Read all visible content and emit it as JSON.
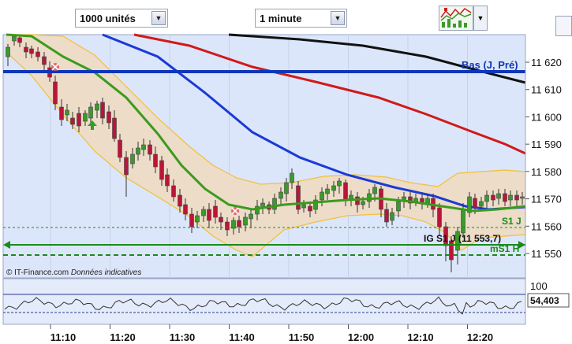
{
  "toolbar": {
    "units_select": "1000 unités",
    "period_select": "1 minute",
    "indicator_tool": "indicator-chart-icon",
    "dropdown_icon": "chevron-down-icon"
  },
  "chart": {
    "price_ticks": [
      "11 620",
      "11 610",
      "11 600",
      "11 590",
      "11 580",
      "11 570",
      "11 560",
      "11 550"
    ],
    "time_ticks": [
      "11:10",
      "11:20",
      "11:30",
      "11:40",
      "11:50",
      "12:00",
      "12:10",
      "12:20"
    ],
    "level_bas": "Bas (J, Pré)",
    "level_s1j": "S1 J",
    "level_ig": "IG S1 J (11 553,7)",
    "level_ms1h": "mS1 H",
    "copyright": "© IT-Finance.com",
    "disclaimer": "Données indicatives",
    "oscillator_top": "100",
    "oscillator_value": "54,403",
    "colors": {
      "background": "#dce6fa",
      "bollinger_fill": "#ecdcc8",
      "bollinger_line": "#f2c03a",
      "ma_green": "#3c9a1e",
      "ma_blue": "#1a3ad6",
      "ma_red": "#d01a1a",
      "ma_black": "#111111",
      "level_blue": "#1036b8",
      "level_green": "#1a8a1a",
      "candle_up": "#3a9a2a",
      "candle_down": "#b8163a"
    }
  }
}
